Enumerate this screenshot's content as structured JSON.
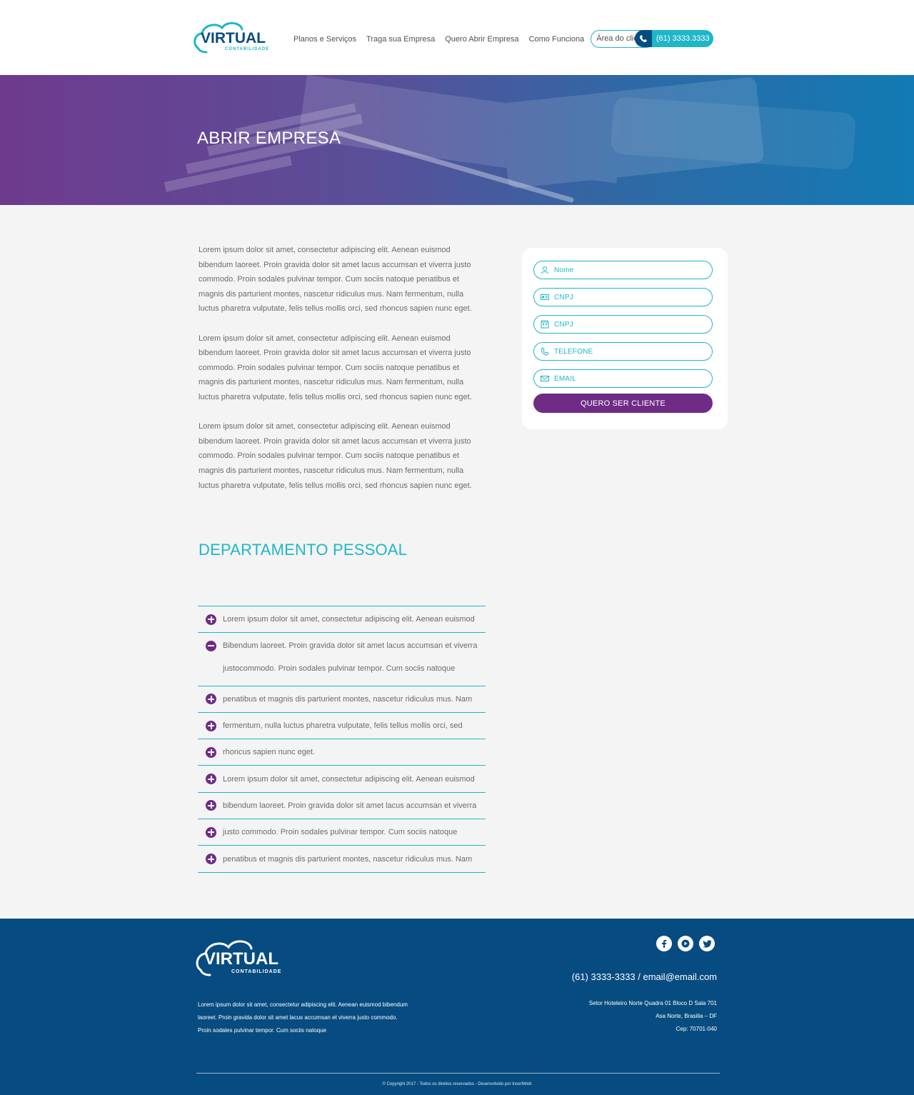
{
  "header": {
    "logo_word": "VIRTUAL",
    "logo_sub": "CONTABILIDADE",
    "nav": [
      "Planos e Serviços",
      "Traga sua Empresa",
      "Quero Abrir Empresa",
      "Como Funciona"
    ],
    "client_area": "Área do cliente",
    "phone": "(61) 3333.3333"
  },
  "hero": {
    "title": "ABRIR EMPRESA"
  },
  "paragraphs": [
    "Lorem ipsum dolor sit amet, consectetur adipiscing elit. Aenean euismod bibendum laoreet. Proin gravida dolor sit amet lacus accumsan et viverra justo commodo. Proin sodales pulvinar tempor. Cum sociis natoque penatibus et magnis dis parturient montes, nascetur ridiculus mus. Nam fermentum, nulla luctus pharetra vulputate, felis tellus mollis orci, sed rhoncus sapien nunc eget.",
    "Lorem ipsum dolor sit amet, consectetur adipiscing elit. Aenean euismod bibendum laoreet. Proin gravida dolor sit amet lacus accumsan et viverra justo commodo. Proin sodales pulvinar tempor. Cum sociis natoque penatibus et magnis dis parturient montes, nascetur ridiculus mus. Nam fermentum, nulla luctus pharetra vulputate, felis tellus mollis orci, sed rhoncus sapien nunc eget.",
    "Lorem ipsum dolor sit amet, consectetur adipiscing elit. Aenean euismod bibendum laoreet. Proin gravida dolor sit amet lacus accumsan et viverra justo commodo. Proin sodales pulvinar tempor. Cum sociis natoque penatibus et magnis dis parturient montes, nascetur ridiculus mus. Nam fermentum, nulla luctus pharetra vulputate, felis tellus mollis orci, sed rhoncus sapien nunc eget."
  ],
  "form": {
    "fields": [
      {
        "label": "Nome",
        "icon": "user-icon"
      },
      {
        "label": "CNPJ",
        "icon": "id-card-icon"
      },
      {
        "label": "CNPJ",
        "icon": "building-icon"
      },
      {
        "label": "TELEFONE",
        "icon": "phone-icon"
      },
      {
        "label": "EMAIL",
        "icon": "envelope-icon"
      }
    ],
    "submit": "QUERO SER CLIENTE"
  },
  "section": {
    "title": "DEPARTAMENTO PESSOAL"
  },
  "accordion": [
    {
      "title": "Lorem ipsum dolor sit amet, consectetur adipiscing elit. Aenean euismod",
      "open": false
    },
    {
      "title": "Bibendum laoreet. Proin gravida dolor sit amet lacus accumsan et viverra",
      "open": true,
      "body": "justocommodo. Proin sodales pulvinar tempor. Cum sociis natoque"
    },
    {
      "title": "penatibus et magnis dis parturient montes, nascetur ridiculus mus. Nam",
      "open": false
    },
    {
      "title": "fermentum, nulla luctus pharetra vulputate, felis tellus mollis orci, sed",
      "open": false
    },
    {
      "title": "rhoncus sapien nunc eget.",
      "open": false
    },
    {
      "title": "Lorem ipsum dolor sit amet, consectetur adipiscing elit. Aenean euismod",
      "open": false
    },
    {
      "title": "bibendum laoreet. Proin gravida dolor sit amet lacus accumsan et viverra",
      "open": false
    },
    {
      "title": "justo commodo. Proin sodales pulvinar tempor. Cum sociis natoque",
      "open": false
    },
    {
      "title": "penatibus et magnis dis parturient montes, nascetur ridiculus mus. Nam",
      "open": false
    }
  ],
  "footer": {
    "description": "Lorem ipsum dolor sit amet, consectetur adipiscing elit. Aenean euismod bibendum laoreet. Proin gravida dolor sit amet lacus accumsan et viverra justo commodo. Proin sodales pulvinar tempor. Cum sociis natoque",
    "contact": "(61) 3333-3333  /  email@email.com",
    "address": [
      "Setor Hoteleiro Norte Quadra 01 Bloco D Sala 701",
      "Asa Norte, Brasilia – DF",
      "Cep: 70701-040"
    ],
    "social": [
      "facebook-icon",
      "youtube-icon",
      "twitter-icon"
    ],
    "copyright": "© Copyright 2017 - Todos os direitos reservados - Desenvolvido por InsertWeb"
  },
  "colors": {
    "accent": "#1fb6c9",
    "purple": "#6f2b86",
    "navy": "#074c80"
  }
}
